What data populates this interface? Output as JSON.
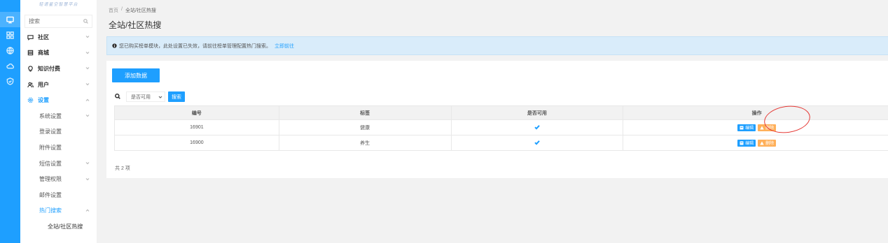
{
  "sidebar": {
    "logo_text": "轻语星空智慧平台",
    "search_placeholder": "搜索",
    "menu": [
      {
        "label": "社区"
      },
      {
        "label": "商城"
      },
      {
        "label": "知识付费"
      },
      {
        "label": "用户"
      },
      {
        "label": "设置"
      }
    ],
    "settings_sub": [
      {
        "label": "系统设置"
      },
      {
        "label": "登录设置"
      },
      {
        "label": "附件设置"
      },
      {
        "label": "短信设置"
      },
      {
        "label": "管理权限"
      },
      {
        "label": "邮件设置"
      },
      {
        "label": "热门搜索"
      }
    ],
    "hot_search_sub": [
      {
        "label": "全站/社区热搜"
      }
    ]
  },
  "breadcrumb": {
    "home": "首页",
    "sep": "/",
    "current": "全站/社区热搜"
  },
  "page_title": "全站/社区热搜",
  "alert": {
    "text": "您已购买榜单模块，此处设置已失效，请前往榜单管理配置热门搜索。",
    "link": "立即前往"
  },
  "toolbar": {
    "add_label": "添加数据"
  },
  "filter": {
    "select_value": "是否可用",
    "search_label": "搜索"
  },
  "table": {
    "headers": [
      "编号",
      "标签",
      "是否可用",
      "操作"
    ],
    "rows": [
      {
        "id": "16901",
        "tag": "健康",
        "enabled": true
      },
      {
        "id": "16900",
        "tag": "养生",
        "enabled": true
      }
    ],
    "edit_label": "编辑",
    "delete_label": "删除"
  },
  "total": "共 2 项",
  "colors": {
    "primary": "#1e9fff",
    "warning": "#ffb05a",
    "annotation": "#e53935"
  }
}
